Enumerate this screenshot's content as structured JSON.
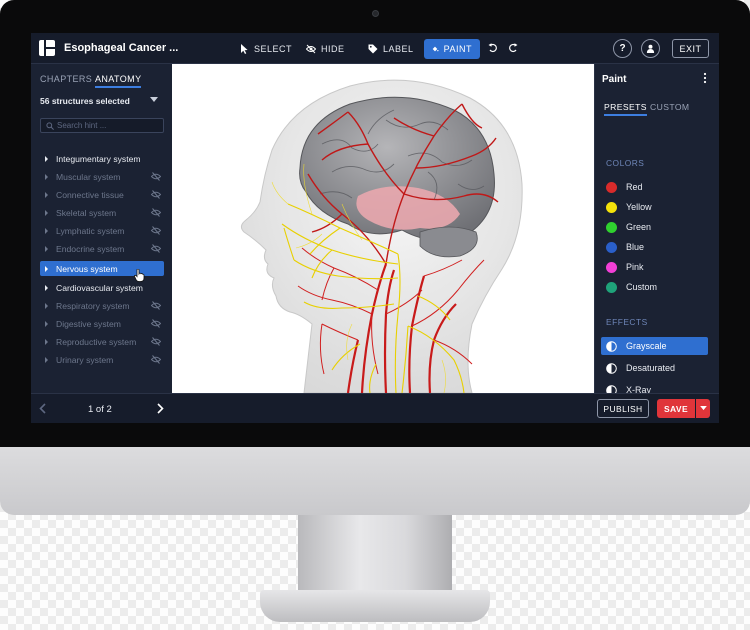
{
  "app": {
    "document_title": "Esophageal Cancer ...",
    "toolbar": {
      "select_label": "SELECT",
      "hide_label": "HIDE",
      "label_label": "LABEL",
      "paint_label": "PAINT",
      "active_tool": "paint"
    },
    "help_label": "?",
    "exit_label": "EXIT",
    "accent_color": "#2f6fd0"
  },
  "left_panel": {
    "tabs": [
      {
        "label": "CHAPTERS",
        "active": false
      },
      {
        "label": "ANATOMY",
        "active": true
      }
    ],
    "selected_count_label": "56 structures selected",
    "search": {
      "placeholder": "Search hint ...",
      "value": ""
    },
    "systems": [
      {
        "label": "Integumentary system",
        "visible": true,
        "selected": false
      },
      {
        "label": "Muscular system",
        "visible": false,
        "selected": false
      },
      {
        "label": "Connective tissue",
        "visible": false,
        "selected": false
      },
      {
        "label": "Skeletal system",
        "visible": false,
        "selected": false
      },
      {
        "label": "Lymphatic system",
        "visible": false,
        "selected": false
      },
      {
        "label": "Endocrine system",
        "visible": false,
        "selected": false
      },
      {
        "label": "Nervous system",
        "visible": true,
        "selected": true
      },
      {
        "label": "Cardiovascular system",
        "visible": true,
        "selected": false
      },
      {
        "label": "Respiratory system",
        "visible": false,
        "selected": false
      },
      {
        "label": "Digestive system",
        "visible": false,
        "selected": false
      },
      {
        "label": "Reproductive system",
        "visible": false,
        "selected": false
      },
      {
        "label": "Urinary system",
        "visible": false,
        "selected": false
      }
    ]
  },
  "right_panel": {
    "title": "Paint",
    "tabs": [
      {
        "label": "PRESETS",
        "active": true
      },
      {
        "label": "CUSTOM",
        "active": false
      }
    ],
    "colors_heading": "COLORS",
    "colors": [
      {
        "label": "Red",
        "color": "#d92b2b"
      },
      {
        "label": "Yellow",
        "color": "#f4e20a"
      },
      {
        "label": "Green",
        "color": "#2fd12f"
      },
      {
        "label": "Blue",
        "color": "#2a5fc9"
      },
      {
        "label": "Pink",
        "color": "#f23fd6"
      },
      {
        "label": "Custom",
        "color": "#1fa37a"
      }
    ],
    "effects_heading": "EFFECTS",
    "effects": [
      {
        "label": "Grayscale",
        "active": true
      },
      {
        "label": "Desaturated",
        "active": false
      },
      {
        "label": "X-Ray",
        "active": false
      }
    ]
  },
  "bottom_bar": {
    "page_indicator": "1 of 2",
    "publish_label": "PUBLISH",
    "save_label": "SAVE",
    "save_color": "#e0353a"
  }
}
